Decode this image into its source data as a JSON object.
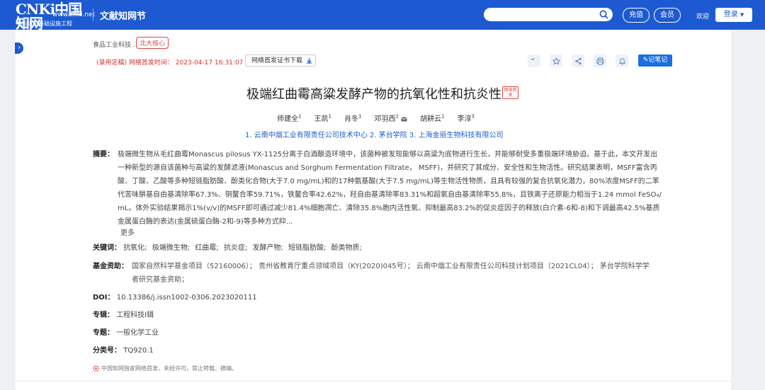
{
  "header": {
    "logo_text": "CNKi中国知网",
    "logo_url": "www.cnki.net",
    "logo_sub": "中国知识基础设施工程",
    "section": "文献知网节",
    "search_placeholder": "",
    "recharge": "充值",
    "member": "会员",
    "welcome": "欢迎",
    "login": "登录"
  },
  "article": {
    "journal": "食品工业科技 .",
    "core_badge": "北大核心",
    "pub_status": "(录用定稿)",
    "pub_label": "网络首发时间：",
    "pub_time": "2023-04-17 16:31:07",
    "cert_download": "网络首发证书下载",
    "note_button": "记笔记",
    "title": "极端红曲霉高粱发酵产物的抗氧化性和抗炎性",
    "title_badge": "网络首发",
    "authors": [
      {
        "name": "师建全",
        "sup": "1"
      },
      {
        "name": "王凯",
        "sup": "1"
      },
      {
        "name": "肖冬",
        "sup": "1"
      },
      {
        "name": "邓羽西",
        "sup": "2"
      },
      {
        "name": "胡耕云",
        "sup": "1"
      },
      {
        "name": "李淳",
        "sup": "3"
      }
    ],
    "affiliations": "1. 云南中烟工业有限责任公司技术中心  2. 茅台学院  3. 上海金丽生物科技有限公司",
    "abstract_label": "摘要：",
    "abstract_lines": [
      "极端微生物从毛红曲霉Monascus pilosus YX-1125分离于白酒酿造环境中，该菌种被发现能够以高粱为底物进行生长，并能够耐受多重极端环境胁迫。基于此，本文开发出",
      "一种新型的源自该菌种与高粱的发酵滤液(Monascus and Sorghum Fermentation Filtrate， MSFF)，并研究了其成分、安全性和生物活性。研究结果表明，MSFF富含丙",
      "酸、丁酸、乙酸等多种短链脂肪酸、酚类化合物(大于7.0 mg/mL)和的17种氨基酸(大于7.5 mg/mL)等生物活性物质，且具有较强的复合抗氧化潜力，80%浓度MSFF的二苯",
      "代苦味肼基自由基清除率67.3%、铜鳌合率59.71%，铁鳌合率42.62%，羟自由基清除率83.31%和超氧自由基清除率55.8%，且铁离子还原能力相当于1.24 mmol FeSO₄/",
      "mL。体外实验结果揭示1%(v/v)的MSFF即可通过减少81.4%细胞凋亡、清除35.8%胞内活性氧、抑制最高83.2%的促炎症因子的释放(白介素-6和-8)和下调最高42.5%基质",
      "金属蛋白酶的表达(金属硫蛋白酶-2和-9)等多种方式抑..."
    ],
    "more": "更多",
    "keywords_label": "关键词：",
    "keywords": [
      "抗氧化;",
      "极端微生物;",
      "红曲霉;",
      "抗炎症;",
      "发酵产物;",
      "短链脂肪酸;",
      "酚类物质;"
    ],
    "fund_label": "基金资助：",
    "fund_lines": [
      "国家自然科学基金项目（52160006）； 贵州省教育厅重点领域项目（KY(2020)045号）； 云南中烟工业有限责任公司科技计划项目（2021CL04）； 茅台学院科学学",
      "者研究基金资助；"
    ],
    "doi_label": "DOI：",
    "doi": "10.13386/j.issn1002-0306.2023020111",
    "series_label": "专辑：",
    "series": "工程科技Ⅰ辑",
    "topic_label": "专题：",
    "topic": "一般化学工业",
    "class_label": "分类号：",
    "class_no": "TQ920.1",
    "footnote": "中国知网独家网络首发，未经许可，禁止转载、摘编。"
  },
  "colors": {
    "brand": "#1d5ad1",
    "alert": "#d43030",
    "note_button": "#1d6fe0"
  }
}
